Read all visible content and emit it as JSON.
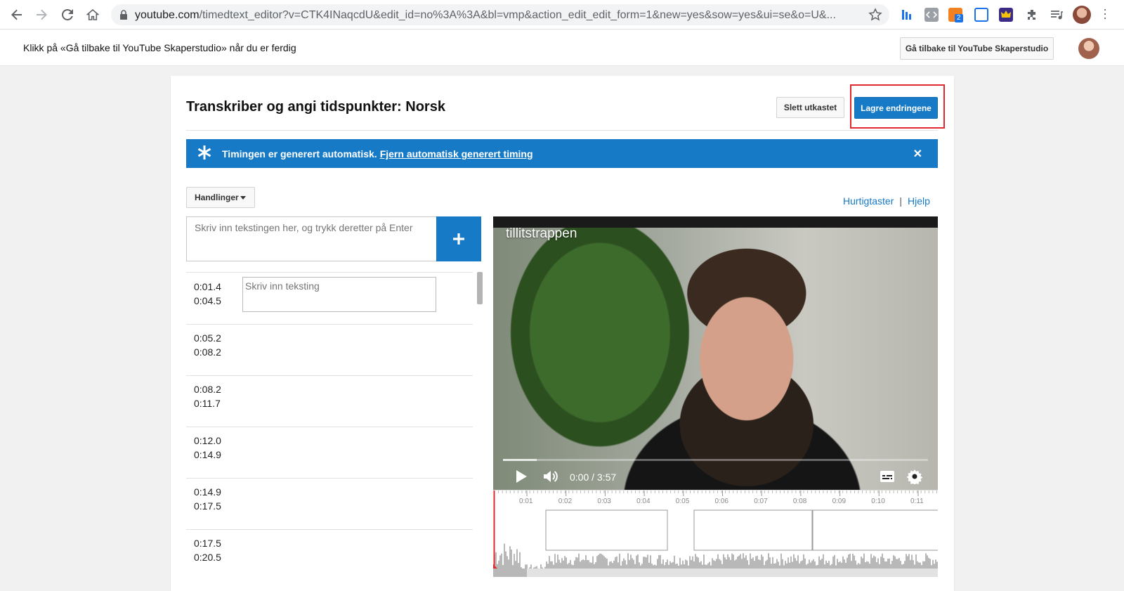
{
  "browser": {
    "url_host": "youtube.com",
    "url_path": "/timedtext_editor?v=CTK4INaqcdU&edit_id=no%3A%3A&bl=vmp&action_edit_edit_form=1&new=yes&sow=yes&ui=se&o=U&...",
    "extension_badge": "2"
  },
  "infobar": {
    "message": "Klikk på «Gå tilbake til YouTube Skaperstudio» når du er ferdig",
    "back_button": "Gå tilbake til YouTube Skaperstudio"
  },
  "editor": {
    "title": "Transkriber og angi tidspunkter: Norsk",
    "discard_button": "Slett utkastet",
    "save_button": "Lagre endringene",
    "banner_text": "Timingen er generert automatisk.",
    "banner_link": "Fjern automatisk generert timing",
    "actions_button": "Handlinger",
    "shortcuts_link": "Hurtigtaster",
    "link_separator": "|",
    "help_link": "Hjelp",
    "caption_input_placeholder": "Skriv inn tekstingen her, og trykk deretter på Enter",
    "caption_edit_placeholder": "Skriv inn teksting"
  },
  "captions": [
    {
      "start": "0:01.4",
      "end": "0:04.5"
    },
    {
      "start": "0:05.2",
      "end": "0:08.2"
    },
    {
      "start": "0:08.2",
      "end": "0:11.7"
    },
    {
      "start": "0:12.0",
      "end": "0:14.9"
    },
    {
      "start": "0:14.9",
      "end": "0:17.5"
    },
    {
      "start": "0:17.5",
      "end": "0:20.5"
    }
  ],
  "video": {
    "title": "tillitstrappen",
    "time": "0:00 / 3:57",
    "buffered_fraction": 0.08
  },
  "timeline": {
    "ticks": [
      "0:01",
      "0:02",
      "0:03",
      "0:04",
      "0:05",
      "0:06",
      "0:07",
      "0:08",
      "0:09",
      "0:10",
      "0:11"
    ]
  },
  "colors": {
    "brand_blue": "#167ac6",
    "highlight_red": "#e0282e"
  }
}
